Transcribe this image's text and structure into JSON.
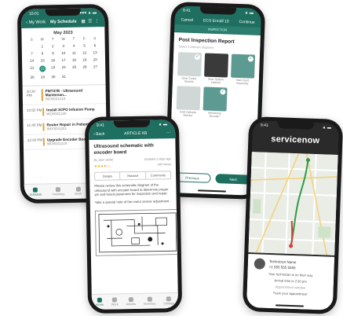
{
  "phone1": {
    "status": {
      "time": "10:01",
      "signal": "●●● ▲ ▬"
    },
    "nav": {
      "back": "‹ My Work",
      "title": "My Schedule"
    },
    "month": "May 2023",
    "dow": [
      "S",
      "M",
      "T",
      "W",
      "T",
      "F",
      "S"
    ],
    "weeks": [
      [
        "",
        "1",
        "2",
        "3",
        "4",
        "5",
        "6"
      ],
      [
        "7",
        "8",
        "9",
        "10",
        "11",
        "12",
        "13"
      ],
      [
        "14",
        "15",
        "16",
        "17",
        "18",
        "19",
        "20"
      ],
      [
        "21",
        "22",
        "23",
        "24",
        "25",
        "26",
        "27"
      ],
      [
        "28",
        "29",
        "30",
        "31",
        "",
        "",
        ""
      ]
    ],
    "today": "22",
    "events": [
      {
        "time": "10:30 PM",
        "title": "PMT47B - Ultrasound Maintenan...",
        "sub": "WO0031218"
      },
      {
        "time": "10:50 PM",
        "title": "Install 3CPO Infusion Pump",
        "sub": "WO0031230"
      },
      {
        "time": "11:45 PM",
        "title": "Router Repair in Patient W...",
        "sub": "WO0031201"
      },
      {
        "time": "12:30 PM",
        "title": "Upgrade Encoder Board",
        "sub": "WO0031219"
      }
    ],
    "tabs": [
      "Schedule",
      "Inventory",
      "Work",
      "Reports"
    ]
  },
  "phone2": {
    "status": {
      "time": "9:41",
      "signal": "▲ ▬"
    },
    "nav": {
      "left": "Cancel",
      "center": "ECS Enrolll 10",
      "right": "Continue"
    },
    "subhead": "INSPECTION",
    "title": "Post Inspection Report",
    "hint": "Select 3 relevant diagrams",
    "tiles": [
      {
        "cap": "Gear Cooler Module",
        "style": "lt",
        "checked": true
      },
      {
        "cap": "Gear System Cabinet",
        "style": "dk",
        "checked": false
      },
      {
        "cap": "Main Fluid Assembly",
        "style": "tl",
        "checked": true
      },
      {
        "cap": "Cold Cathode Monitor",
        "style": "lt",
        "checked": false
      },
      {
        "cap": "Monitoring Encoder",
        "style": "tl",
        "checked": true
      }
    ],
    "check_glyph": "✓",
    "btn_prev": "Previous",
    "btn_next": "Next"
  },
  "phone3": {
    "status": {
      "time": "9:41",
      "signal": "▲ ▬"
    },
    "nav": {
      "back": "‹ Back",
      "title": "ARTICLE KB"
    },
    "title": "Ultrasound schematic with encoder board",
    "author": "By John Smith",
    "updated": "Updated 2 days ago",
    "stars": "★★★★☆",
    "views": "340 Views",
    "tabs": [
      "Details",
      "Related",
      "Comments"
    ],
    "para1": "Please review this schematic diagram of the ultrasound with encoder board to determine proper pin and board placement for inspection and repair.",
    "para2": "Take a special note of the motor sensor adjustment.",
    "tabs_bottom": [
      "Home",
      "Work",
      "Articles",
      "Inventory",
      "Settings"
    ]
  },
  "phone4": {
    "status": {
      "time": "9:41",
      "signal": "▲ ▬"
    },
    "brand": "servicenow",
    "tech_name": "Technician Name",
    "tech_phone": "+1 555 555 5555",
    "line1": "Your technician is on their way",
    "line2": "Arrival time is 2:30 pm",
    "line3": "Appointment window",
    "line4": "Track your appointment"
  }
}
